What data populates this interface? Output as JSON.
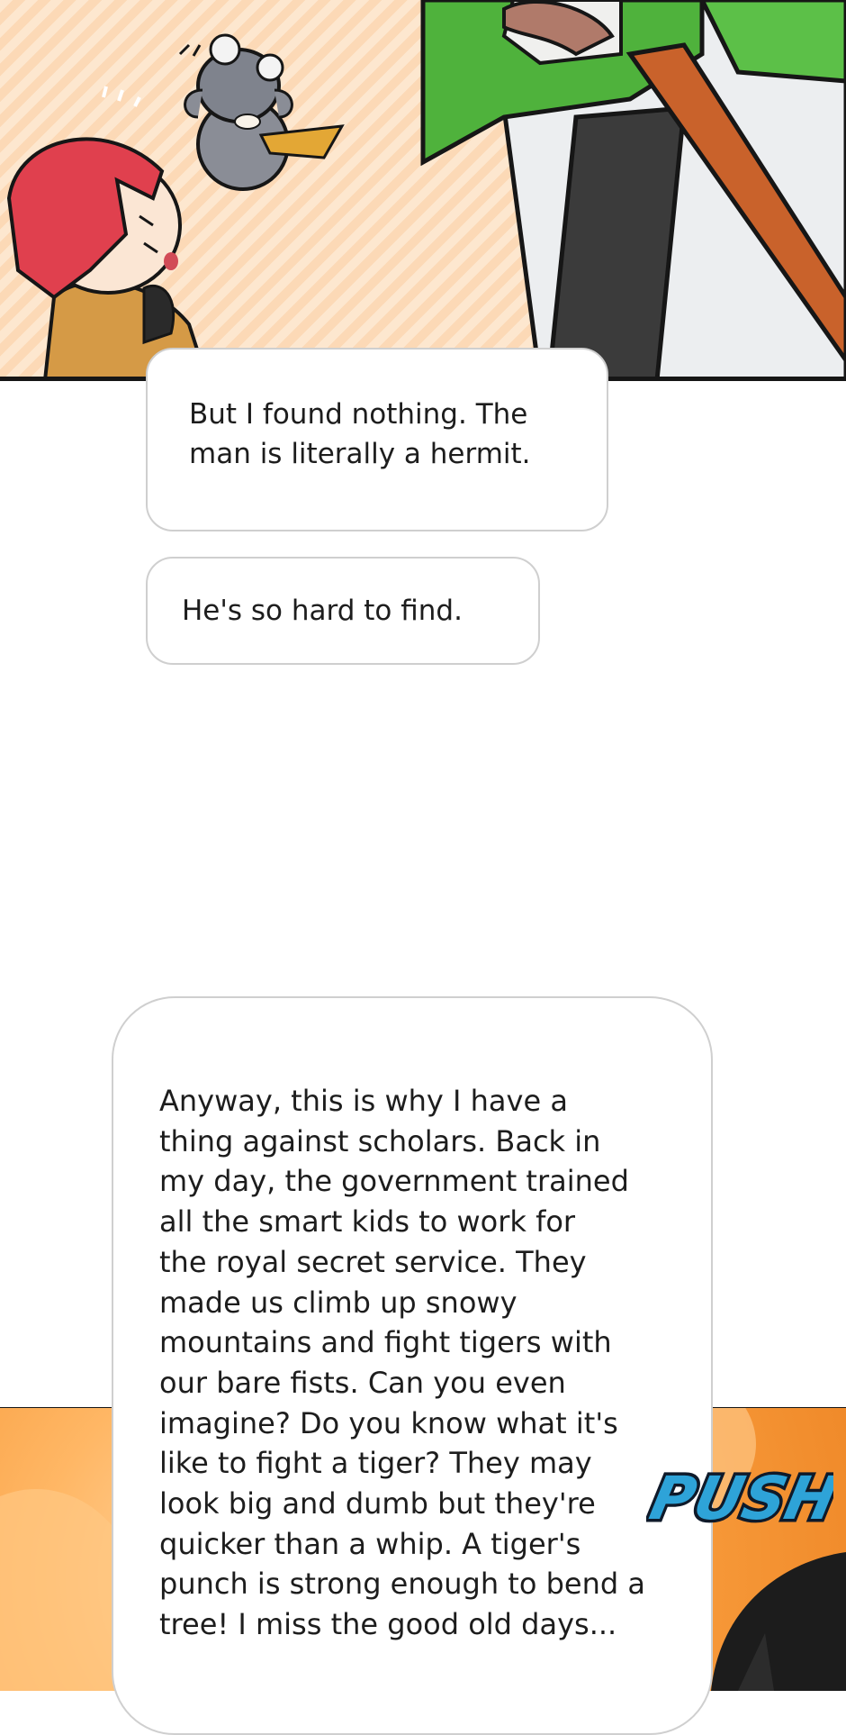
{
  "panel_top": {
    "background": "#fde7cf",
    "stripe": "#fcd9b6",
    "border": "#161616"
  },
  "panel_bottom": {
    "background": "#f79a3a"
  },
  "bubbles": [
    {
      "lines": [
        "But I found nothing. The",
        "man is literally a hermit."
      ]
    },
    {
      "lines": [
        "He's so hard to find."
      ]
    },
    {
      "lines": [
        "Anyway, this is why I have a",
        "thing against scholars. Back in",
        "my day, the government trained",
        "all the smart kids to work for",
        "the royal secret service. They",
        "made us climb up snowy",
        "mountains and fight tigers with",
        "our bare fists. Can you even",
        "imagine? Do you know what it's",
        "like to fight a tiger? They may",
        "look big and dumb but they're",
        "quicker than a whip. A tiger's",
        "punch is strong enough to bend a",
        "tree! I miss the good old days..."
      ]
    }
  ],
  "sfx": {
    "text": "PUSH",
    "fill": "#2ea3d8",
    "outline": "#0f1a2a"
  }
}
